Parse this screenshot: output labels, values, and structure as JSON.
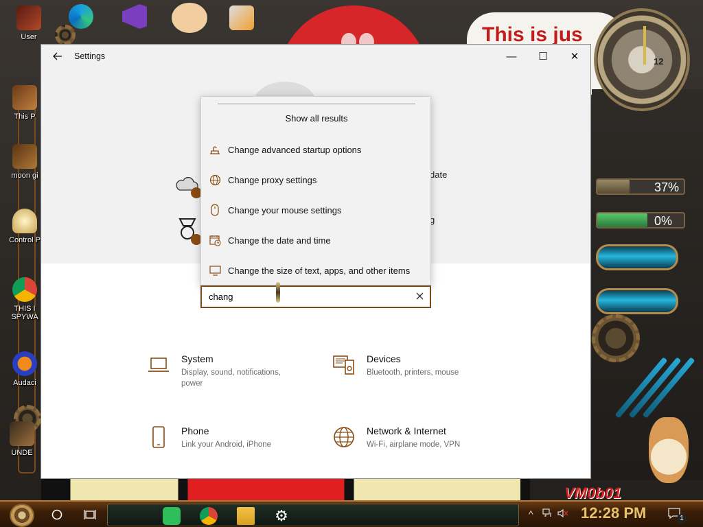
{
  "desktop": {
    "icons": [
      {
        "label": "User"
      },
      {
        "label": "This P"
      },
      {
        "label": "moon gi"
      },
      {
        "label": "Control P"
      },
      {
        "label": "THIS I"
      },
      {
        "label": "SPYWA"
      },
      {
        "label": "Audaci"
      },
      {
        "label": "UNDE"
      }
    ],
    "cartoon_text": "This is jus",
    "clock_numeral": "12",
    "meters": [
      {
        "label": "37%",
        "value": 0.37
      },
      {
        "label": "0%",
        "value": 0.0
      }
    ],
    "watermark": "VM0b01"
  },
  "window": {
    "title": "Settings",
    "controls": {
      "minimize": "—",
      "maximize": "☐",
      "close": "✕"
    },
    "hero_items": [
      {
        "label": "date"
      },
      {
        "label": "g"
      }
    ]
  },
  "search": {
    "value": "chang",
    "show_all": "Show all results",
    "results": [
      {
        "label": "Change advanced startup options",
        "icon": "startup-icon"
      },
      {
        "label": "Change proxy settings",
        "icon": "globe-icon"
      },
      {
        "label": "Change your mouse settings",
        "icon": "mouse-icon"
      },
      {
        "label": "Change the date and time",
        "icon": "calendar-clock-icon"
      },
      {
        "label": "Change the size of text, apps, and other items",
        "icon": "display-icon"
      }
    ]
  },
  "categories": [
    {
      "title": "System",
      "desc": "Display, sound, notifications, power",
      "icon": "laptop-icon"
    },
    {
      "title": "Devices",
      "desc": "Bluetooth, printers, mouse",
      "icon": "devices-icon"
    },
    {
      "title": "Phone",
      "desc": "Link your Android, iPhone",
      "icon": "phone-icon"
    },
    {
      "title": "Network & Internet",
      "desc": "Wi-Fi, airplane mode, VPN",
      "icon": "globe-icon"
    }
  ],
  "taskbar": {
    "time": "12:28 PM",
    "notification_count": "1"
  },
  "colors": {
    "accent": "#7a4a18",
    "icon_brown": "#8a4d12"
  }
}
